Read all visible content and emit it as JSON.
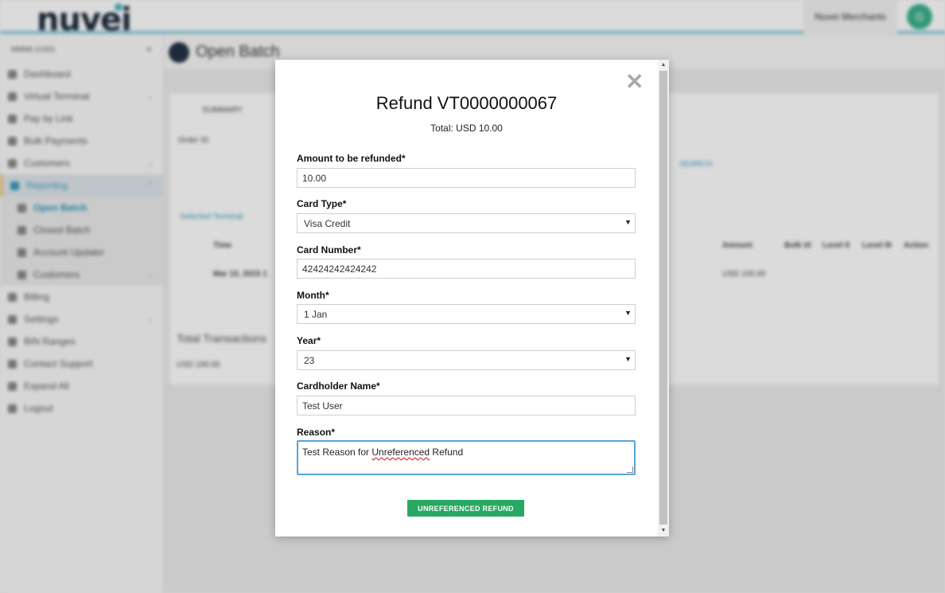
{
  "app": {
    "logo": "nuvei",
    "merchant": "Nuvei Merchants",
    "avatar_initial": "G"
  },
  "sidebar": {
    "select": "MMM6 (USD)",
    "items": [
      {
        "label": "Dashboard"
      },
      {
        "label": "Virtual Terminal"
      },
      {
        "label": "Pay by Link"
      },
      {
        "label": "Bulk Payments"
      },
      {
        "label": "Customers"
      },
      {
        "label": "Reporting"
      },
      {
        "label": "Open Batch"
      },
      {
        "label": "Closed Batch"
      },
      {
        "label": "Account Updater"
      },
      {
        "label": "Customers"
      },
      {
        "label": "Billing"
      },
      {
        "label": "Settings"
      },
      {
        "label": "BIN Ranges"
      },
      {
        "label": "Contact Support"
      },
      {
        "label": "Expand All"
      },
      {
        "label": "Logout"
      }
    ]
  },
  "main": {
    "title": "Open Batch",
    "summary_tab": "SUMMARY",
    "order_label": "Order ID",
    "search_btn": "SEARCH",
    "selected_terminal": "Selected Terminal",
    "cols": [
      "Time",
      "Amount",
      "Bulk Id",
      "Level II",
      "Level III",
      "Action"
    ],
    "row": {
      "time": "Mar 10, 2023 1",
      "amount": "USD 100.00"
    },
    "total_label": "Total Transactions",
    "total_value": "USD 100.00"
  },
  "modal": {
    "title": "Refund VT0000000067",
    "total": "Total: USD 10.00",
    "amount_label": "Amount to be refunded*",
    "amount_value": "10.00",
    "card_type_label": "Card Type*",
    "card_type_value": "Visa Credit",
    "card_number_label": "Card Number*",
    "card_number_value": "42424242424242",
    "month_label": "Month*",
    "month_value": "1 Jan",
    "year_label": "Year*",
    "year_value": "23",
    "cardholder_label": "Cardholder Name*",
    "cardholder_value": "Test User",
    "reason_label": "Reason*",
    "reason_prefix": "Test Reason for ",
    "reason_misspelled": "Unreferenced",
    "reason_suffix": " Refund",
    "submit_label": "UNREFERENCED REFUND",
    "close_symbol": "✕"
  },
  "colors": {
    "accent": "#28a862",
    "focus": "#5aa4d2",
    "topbar_line": "#6cc0d8"
  }
}
